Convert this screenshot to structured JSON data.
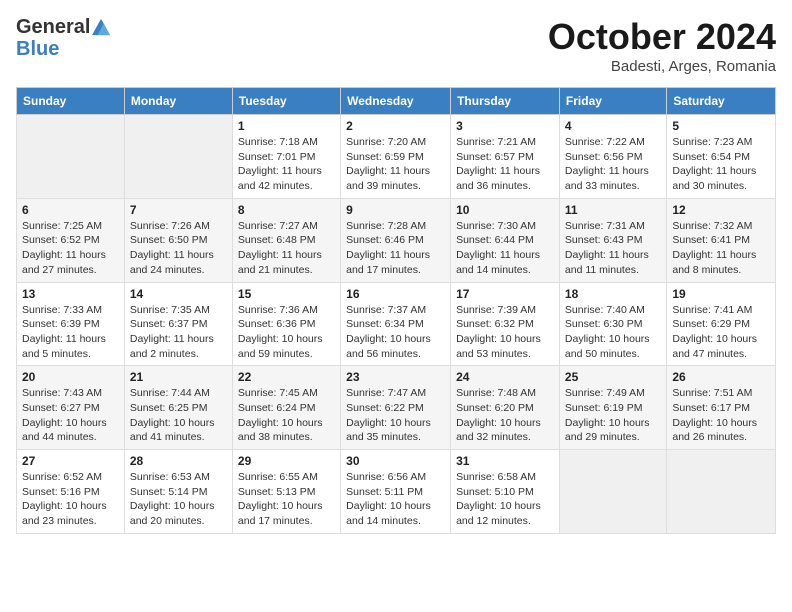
{
  "header": {
    "logo_general": "General",
    "logo_blue": "Blue",
    "month_title": "October 2024",
    "location": "Badesti, Arges, Romania"
  },
  "columns": [
    "Sunday",
    "Monday",
    "Tuesday",
    "Wednesday",
    "Thursday",
    "Friday",
    "Saturday"
  ],
  "weeks": [
    [
      {
        "day": "",
        "sunrise": "",
        "sunset": "",
        "daylight": ""
      },
      {
        "day": "",
        "sunrise": "",
        "sunset": "",
        "daylight": ""
      },
      {
        "day": "1",
        "sunrise": "Sunrise: 7:18 AM",
        "sunset": "Sunset: 7:01 PM",
        "daylight": "Daylight: 11 hours and 42 minutes."
      },
      {
        "day": "2",
        "sunrise": "Sunrise: 7:20 AM",
        "sunset": "Sunset: 6:59 PM",
        "daylight": "Daylight: 11 hours and 39 minutes."
      },
      {
        "day": "3",
        "sunrise": "Sunrise: 7:21 AM",
        "sunset": "Sunset: 6:57 PM",
        "daylight": "Daylight: 11 hours and 36 minutes."
      },
      {
        "day": "4",
        "sunrise": "Sunrise: 7:22 AM",
        "sunset": "Sunset: 6:56 PM",
        "daylight": "Daylight: 11 hours and 33 minutes."
      },
      {
        "day": "5",
        "sunrise": "Sunrise: 7:23 AM",
        "sunset": "Sunset: 6:54 PM",
        "daylight": "Daylight: 11 hours and 30 minutes."
      }
    ],
    [
      {
        "day": "6",
        "sunrise": "Sunrise: 7:25 AM",
        "sunset": "Sunset: 6:52 PM",
        "daylight": "Daylight: 11 hours and 27 minutes."
      },
      {
        "day": "7",
        "sunrise": "Sunrise: 7:26 AM",
        "sunset": "Sunset: 6:50 PM",
        "daylight": "Daylight: 11 hours and 24 minutes."
      },
      {
        "day": "8",
        "sunrise": "Sunrise: 7:27 AM",
        "sunset": "Sunset: 6:48 PM",
        "daylight": "Daylight: 11 hours and 21 minutes."
      },
      {
        "day": "9",
        "sunrise": "Sunrise: 7:28 AM",
        "sunset": "Sunset: 6:46 PM",
        "daylight": "Daylight: 11 hours and 17 minutes."
      },
      {
        "day": "10",
        "sunrise": "Sunrise: 7:30 AM",
        "sunset": "Sunset: 6:44 PM",
        "daylight": "Daylight: 11 hours and 14 minutes."
      },
      {
        "day": "11",
        "sunrise": "Sunrise: 7:31 AM",
        "sunset": "Sunset: 6:43 PM",
        "daylight": "Daylight: 11 hours and 11 minutes."
      },
      {
        "day": "12",
        "sunrise": "Sunrise: 7:32 AM",
        "sunset": "Sunset: 6:41 PM",
        "daylight": "Daylight: 11 hours and 8 minutes."
      }
    ],
    [
      {
        "day": "13",
        "sunrise": "Sunrise: 7:33 AM",
        "sunset": "Sunset: 6:39 PM",
        "daylight": "Daylight: 11 hours and 5 minutes."
      },
      {
        "day": "14",
        "sunrise": "Sunrise: 7:35 AM",
        "sunset": "Sunset: 6:37 PM",
        "daylight": "Daylight: 11 hours and 2 minutes."
      },
      {
        "day": "15",
        "sunrise": "Sunrise: 7:36 AM",
        "sunset": "Sunset: 6:36 PM",
        "daylight": "Daylight: 10 hours and 59 minutes."
      },
      {
        "day": "16",
        "sunrise": "Sunrise: 7:37 AM",
        "sunset": "Sunset: 6:34 PM",
        "daylight": "Daylight: 10 hours and 56 minutes."
      },
      {
        "day": "17",
        "sunrise": "Sunrise: 7:39 AM",
        "sunset": "Sunset: 6:32 PM",
        "daylight": "Daylight: 10 hours and 53 minutes."
      },
      {
        "day": "18",
        "sunrise": "Sunrise: 7:40 AM",
        "sunset": "Sunset: 6:30 PM",
        "daylight": "Daylight: 10 hours and 50 minutes."
      },
      {
        "day": "19",
        "sunrise": "Sunrise: 7:41 AM",
        "sunset": "Sunset: 6:29 PM",
        "daylight": "Daylight: 10 hours and 47 minutes."
      }
    ],
    [
      {
        "day": "20",
        "sunrise": "Sunrise: 7:43 AM",
        "sunset": "Sunset: 6:27 PM",
        "daylight": "Daylight: 10 hours and 44 minutes."
      },
      {
        "day": "21",
        "sunrise": "Sunrise: 7:44 AM",
        "sunset": "Sunset: 6:25 PM",
        "daylight": "Daylight: 10 hours and 41 minutes."
      },
      {
        "day": "22",
        "sunrise": "Sunrise: 7:45 AM",
        "sunset": "Sunset: 6:24 PM",
        "daylight": "Daylight: 10 hours and 38 minutes."
      },
      {
        "day": "23",
        "sunrise": "Sunrise: 7:47 AM",
        "sunset": "Sunset: 6:22 PM",
        "daylight": "Daylight: 10 hours and 35 minutes."
      },
      {
        "day": "24",
        "sunrise": "Sunrise: 7:48 AM",
        "sunset": "Sunset: 6:20 PM",
        "daylight": "Daylight: 10 hours and 32 minutes."
      },
      {
        "day": "25",
        "sunrise": "Sunrise: 7:49 AM",
        "sunset": "Sunset: 6:19 PM",
        "daylight": "Daylight: 10 hours and 29 minutes."
      },
      {
        "day": "26",
        "sunrise": "Sunrise: 7:51 AM",
        "sunset": "Sunset: 6:17 PM",
        "daylight": "Daylight: 10 hours and 26 minutes."
      }
    ],
    [
      {
        "day": "27",
        "sunrise": "Sunrise: 6:52 AM",
        "sunset": "Sunset: 5:16 PM",
        "daylight": "Daylight: 10 hours and 23 minutes."
      },
      {
        "day": "28",
        "sunrise": "Sunrise: 6:53 AM",
        "sunset": "Sunset: 5:14 PM",
        "daylight": "Daylight: 10 hours and 20 minutes."
      },
      {
        "day": "29",
        "sunrise": "Sunrise: 6:55 AM",
        "sunset": "Sunset: 5:13 PM",
        "daylight": "Daylight: 10 hours and 17 minutes."
      },
      {
        "day": "30",
        "sunrise": "Sunrise: 6:56 AM",
        "sunset": "Sunset: 5:11 PM",
        "daylight": "Daylight: 10 hours and 14 minutes."
      },
      {
        "day": "31",
        "sunrise": "Sunrise: 6:58 AM",
        "sunset": "Sunset: 5:10 PM",
        "daylight": "Daylight: 10 hours and 12 minutes."
      },
      {
        "day": "",
        "sunrise": "",
        "sunset": "",
        "daylight": ""
      },
      {
        "day": "",
        "sunrise": "",
        "sunset": "",
        "daylight": ""
      }
    ]
  ]
}
